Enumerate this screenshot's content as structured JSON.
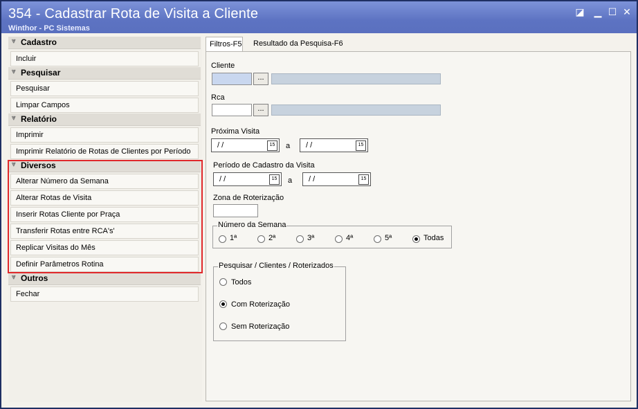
{
  "window": {
    "title": "354 - Cadastrar Rota de Visita a Cliente",
    "subtitle": "Winthor - PC Sistemas"
  },
  "sidebar": {
    "groups": [
      {
        "header": "Cadastro",
        "items": [
          "Incluir"
        ]
      },
      {
        "header": "Pesquisar",
        "items": [
          "Pesquisar",
          "Limpar Campos"
        ]
      },
      {
        "header": "Relatório",
        "items": [
          "Imprimir",
          "Imprimir Relatório de Rotas de Clientes por Período"
        ]
      },
      {
        "header": "Diversos",
        "items": [
          "Alterar Número da Semana",
          "Alterar Rotas de Visita",
          "Inserir Rotas Cliente por Praça",
          "Transferir Rotas entre RCA's'",
          "Replicar Visitas do Mês",
          "Definir Parâmetros Rotina"
        ]
      },
      {
        "header": "Outros",
        "items": [
          "Fechar"
        ]
      }
    ]
  },
  "tabs": [
    {
      "label": "Filtros-F5",
      "active": true
    },
    {
      "label": "Resultado da Pesquisa-F6",
      "active": false
    }
  ],
  "form": {
    "cliente_label": "Cliente",
    "rca_label": "Rca",
    "browse_button": "...",
    "proxima_visita_label": "Próxima Visita",
    "periodo_cadastro_label": "Período de Cadastro da Visita",
    "date_empty": "/ /",
    "date_separator": "a",
    "calendar_glyph": "15",
    "zona_label": "Zona de Roterização",
    "semana": {
      "title": "Número da Semana",
      "options": [
        "1ª",
        "2ª",
        "3ª",
        "4ª",
        "5ª",
        "Todas"
      ],
      "selected": "Todas"
    },
    "roterizados": {
      "title": "Pesquisar / Clientes / Roterizados",
      "options": [
        "Todos",
        "Com Roterização",
        "Sem Roterização"
      ],
      "selected": "Com Roterização"
    }
  },
  "colors": {
    "titlebar": "#5d73c2",
    "highlight_border": "#e0282b"
  }
}
